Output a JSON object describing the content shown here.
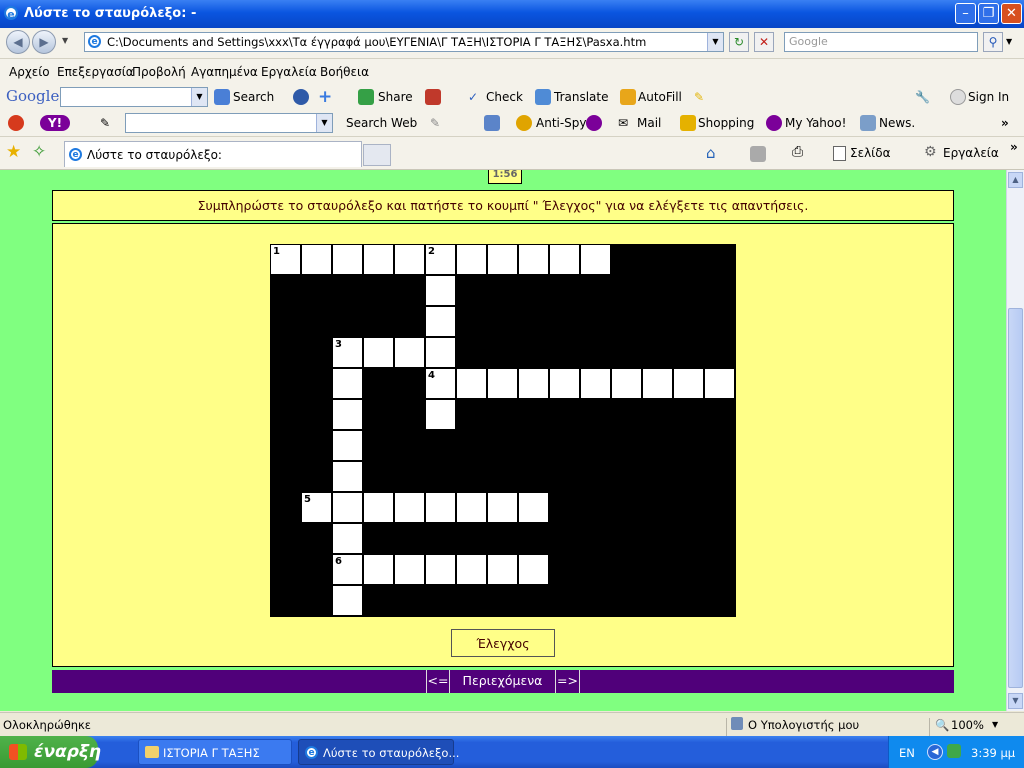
{
  "window": {
    "title": "Λύστε το σταυρόλεξο: -",
    "address": "C:\\Documents and Settings\\xxx\\Τα έγγραφά μου\\ΕΥΓΕΝΙΑ\\Γ ΤΑΞΗ\\ΙΣΤΟΡΙΑ Γ ΤΑΞΗΣ\\Pasxa.htm",
    "search_placeholder": "Google"
  },
  "menu": [
    "Αρχείο",
    "Επεξεργασία",
    "Προβολή",
    "Αγαπημένα",
    "Εργαλεία",
    "Βοήθεια"
  ],
  "google_toolbar": {
    "logo": "Google",
    "search": "Search",
    "share": "Share",
    "check": "Check",
    "translate": "Translate",
    "autofill": "AutoFill",
    "sign_in": "Sign In"
  },
  "yahoo_toolbar": {
    "search_web": "Search Web",
    "anti_spy": "Anti-Spy",
    "mail": "Mail",
    "shopping": "Shopping",
    "my_yahoo": "My Yahoo!",
    "news": "News."
  },
  "tab": {
    "title": "Λύστε το σταυρόλεξο:"
  },
  "command_bar": {
    "page": "Σελίδα",
    "tools": "Εργαλεία"
  },
  "page": {
    "timer": "1:56",
    "instructions": "Συμπληρώστε το σταυρόλεξο και πατήστε το κουμπί \" Έλεγχος\" για να ελέγξετε τις απαντήσεις.",
    "check_button": "Έλεγχος",
    "nav_prev": "<=",
    "nav_contents": "Περιεχόμενα",
    "nav_next": "=>"
  },
  "crossword": {
    "cols": 15,
    "rows": 12,
    "clues": [
      {
        "number": "1",
        "direction": "across",
        "row": 0,
        "col": 0,
        "length": 11
      },
      {
        "number": "2",
        "direction": "down",
        "row": 0,
        "col": 5,
        "length": 6
      },
      {
        "number": "3",
        "direction": "across",
        "row": 3,
        "col": 2,
        "length": 4
      },
      {
        "number": "3",
        "direction": "down",
        "row": 3,
        "col": 2,
        "length": 9
      },
      {
        "number": "4",
        "direction": "across",
        "row": 4,
        "col": 5,
        "length": 10
      },
      {
        "number": "5",
        "direction": "across",
        "row": 8,
        "col": 1,
        "length": 8
      },
      {
        "number": "6",
        "direction": "across",
        "row": 10,
        "col": 2,
        "length": 7
      }
    ]
  },
  "status": {
    "text": "Ολοκληρώθηκε",
    "zone": "Ο Υπολογιστής μου",
    "zoom": "100%"
  },
  "taskbar": {
    "start": "έναρξη",
    "tasks": [
      "ΙΣΤΟΡΙΑ Γ ΤΑΞΗΣ",
      "Λύστε το σταυρόλεξο..."
    ],
    "lang": "EN",
    "clock": "3:39 μμ"
  },
  "colors": {
    "page_bg": "#80ff80",
    "panel_bg": "#ffff88",
    "nav_bg": "#50007a"
  }
}
